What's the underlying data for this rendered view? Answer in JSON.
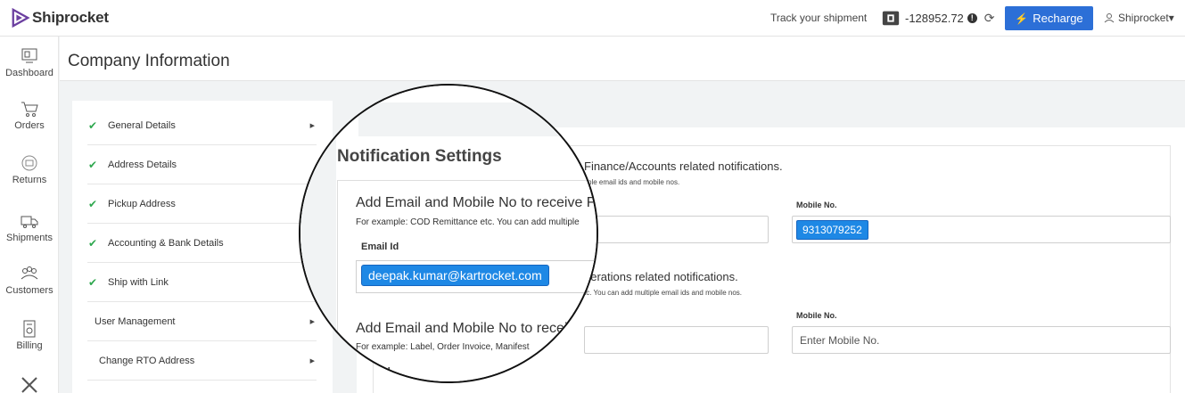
{
  "app": {
    "brand": "Shiprocket"
  },
  "topbar": {
    "track_label": "Track your shipment",
    "balance": "-128952.72",
    "info_glyph": "!",
    "refresh_glyph": "⟳",
    "recharge_label": "Recharge",
    "user_label": "Shiprocket▾",
    "accent": "#2c6fd7"
  },
  "nav": [
    {
      "label": "Dashboard",
      "icon": "dashboard-icon"
    },
    {
      "label": "Orders",
      "icon": "cart-icon"
    },
    {
      "label": "Returns",
      "icon": "returns-icon"
    },
    {
      "label": "Shipments",
      "icon": "truck-icon"
    },
    {
      "label": "Customers",
      "icon": "customers-icon"
    },
    {
      "label": "Billing",
      "icon": "billing-icon"
    },
    {
      "label": "",
      "icon": "tools-icon"
    }
  ],
  "page": {
    "title": "Company Information"
  },
  "menu": [
    {
      "label": "General Details",
      "checked": true
    },
    {
      "label": "Address Details",
      "checked": true
    },
    {
      "label": "Pickup Address",
      "checked": true
    },
    {
      "label": "Accounting & Bank Details",
      "checked": true
    },
    {
      "label": "Ship with Link",
      "checked": true
    },
    {
      "label": "User Management",
      "checked": false
    },
    {
      "label": "Change RTO Address",
      "checked": false
    }
  ],
  "notifications": {
    "title": "Notification Settings",
    "finance": {
      "heading": "Add Email and Mobile No to receive Finance/Accounts related notifications.",
      "heading_visible_right": "Finance/Accounts related notifications.",
      "sub": "For example: COD Remittance etc. You can add multiple email ids and mobile nos.",
      "sub_visible_right": "tiple email ids and mobile nos.",
      "email_label": "Email Id",
      "email_value": "deepak.kumar@kartrocket.com",
      "mobile_label": "Mobile No.",
      "mobile_value": "9313079252"
    },
    "operations": {
      "heading_visible_right": "perations related notifications.",
      "sub_visible_right": "tc. You can add multiple email ids and mobile nos.",
      "mobile_label": "Mobile No.",
      "mobile_placeholder": "Enter Mobile No."
    },
    "label_orders": {
      "heading_visible": "Add Email and Mobile No to receiv",
      "sub_visible": "For example: Label, Order Invoice, Manifest",
      "email_label_partial": "d"
    }
  },
  "lens_text": {
    "finance_heading": "Add Email and Mobile No to receive Fin",
    "finance_sub": "For example: COD Remittance etc. You can add multiple"
  }
}
